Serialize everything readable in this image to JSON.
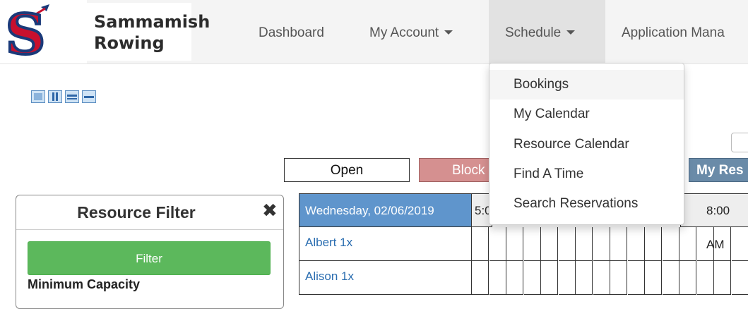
{
  "brand": {
    "line1": "Sammamish",
    "line2": "Rowing",
    "logo_letter": "S"
  },
  "nav": {
    "items": [
      {
        "label": "Dashboard",
        "dropdown": false
      },
      {
        "label": "My Account",
        "dropdown": true
      },
      {
        "label": "Schedule",
        "dropdown": true,
        "active": true
      },
      {
        "label": "Application Mana",
        "dropdown": false
      }
    ]
  },
  "schedule_menu": {
    "items": [
      {
        "label": "Bookings"
      },
      {
        "label": "My Calendar"
      },
      {
        "label": "Resource Calendar"
      },
      {
        "label": "Find A Time"
      },
      {
        "label": "Search Reservations"
      }
    ]
  },
  "legend": {
    "open": "Open",
    "blocked": "Block",
    "my_reservations": "My Res"
  },
  "filter": {
    "title": "Resource Filter",
    "button": "Filter",
    "min_capacity_label": "Minimum Capacity"
  },
  "grid": {
    "date": "Wednesday, 02/06/2019",
    "times": [
      "5:0",
      "8:00 AM"
    ],
    "rows": [
      "Albert 1x",
      "Alison 1x"
    ]
  },
  "colors": {
    "accent": "#5f95cc",
    "filter_green": "#5cb85c",
    "blocked": "#d59090",
    "my_res": "#6a8ba8"
  }
}
